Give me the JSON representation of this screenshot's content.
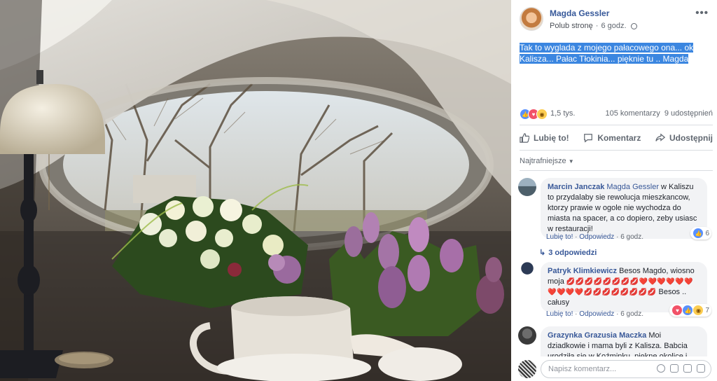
{
  "post": {
    "page_name": "Magda Gessler",
    "follow_label": "Polub stronę",
    "dot": "·",
    "time": "6 godz.",
    "text": "Tak to wyglada z mojego pałacowego ona... ok Kalisza... Pałac Tłokinia... pięknie tu .. Magda",
    "more_label": "•••"
  },
  "stats": {
    "reactions": "1,5 tys.",
    "comments": "105 komentarzy",
    "shares": "9 udostępnień"
  },
  "actions": {
    "like": "Lubię to!",
    "comment": "Komentarz",
    "share": "Udostępnij"
  },
  "sort": {
    "label": "Najtrafniejsze"
  },
  "comments": [
    {
      "author": "Marcin Janczak",
      "mention": "Magda Gessler",
      "text": "w Kaliszu to przydalaby sie rewolucja mieszkancow, ktorzy prawie w ogole nie wychodza do miasta na spacer, a co dopiero, zeby usiasc w restauracji!",
      "like": "Lubię to!",
      "reply": "Odpowiedz",
      "time": "6 godz.",
      "reaction_count": "6"
    },
    {
      "author": "Patryk Klimkiewicz",
      "text": "Besos Magdo, wiosno moja",
      "hearts1": "💋💋💋💋💋💋💋💋❤️❤️❤️❤️❤️❤️",
      "hearts2": "❤️❤️❤️❤️💋💋💋💋💋💋💋💋",
      "text_end": "Besos .. całusy",
      "like": "Lubię to!",
      "reply": "Odpowiedz",
      "time": "6 godz.",
      "reaction_count": "7"
    },
    {
      "author": "Grazynka Grazusia Maczka",
      "text": "Moi dziadkowie i mama byli z Kalisza. Babcia urodziła się w Koźminku, piękne okolice i mili"
    }
  ],
  "replies_label": "3 odpowiedzi",
  "dot": "·",
  "composer": {
    "placeholder": "Napisz komentarz..."
  },
  "colors": {
    "link": "#385898",
    "highlight": "#3b86e0",
    "bubble": "#f2f3f5"
  }
}
